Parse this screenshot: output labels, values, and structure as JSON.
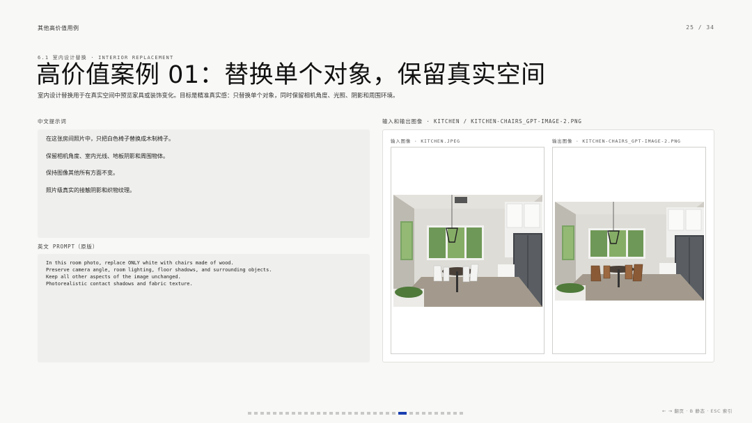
{
  "header": {
    "doc_title": "其他高价值用例",
    "page_counter": "25 / 34"
  },
  "section": {
    "label": "6.1  室内设计替换 · INTERIOR REPLACEMENT",
    "title": "高价值案例 01：替换单个对象，保留真实空间",
    "description": "室内设计替换用于在真实空间中预览家具或装饰变化。目标是精准真实感：只替换单个对象，同时保留相机角度、光照、阴影和周围环境。"
  },
  "prompt_zh": {
    "label": "中文提示词",
    "lines": [
      "在这张房间照片中，只把白色椅子替换成木制椅子。",
      "保留相机角度、室内光线、地板阴影和周围物体。",
      "保持图像其他所有方面不变。",
      "照片级真实的接触阴影和织物纹理。"
    ]
  },
  "prompt_en": {
    "label": "英文 PROMPT（原版）",
    "lines": [
      "In this room photo, replace ONLY white with chairs made of wood.",
      "Preserve camera angle, room lighting, floor shadows, and surrounding objects.",
      "Keep all other aspects of the image unchanged.",
      "Photorealistic contact shadows and fabric texture."
    ]
  },
  "images": {
    "label": "输入和输出图像 · KITCHEN / KITCHEN-CHAIRS_GPT-IMAGE-2.PNG",
    "input_label": "输入图像 · KITCHEN.JPEG",
    "output_label": "输出图像 · KITCHEN-CHAIRS_GPT-IMAGE-2.PNG"
  },
  "footer": {
    "nav_hint": "← → 翻页 · B 静态 · ESC 索引",
    "total_pages": 34,
    "current_page": 25
  },
  "colors": {
    "accent": "#1a3fb0",
    "background": "#f8f8f6",
    "panel": "#efefed"
  }
}
